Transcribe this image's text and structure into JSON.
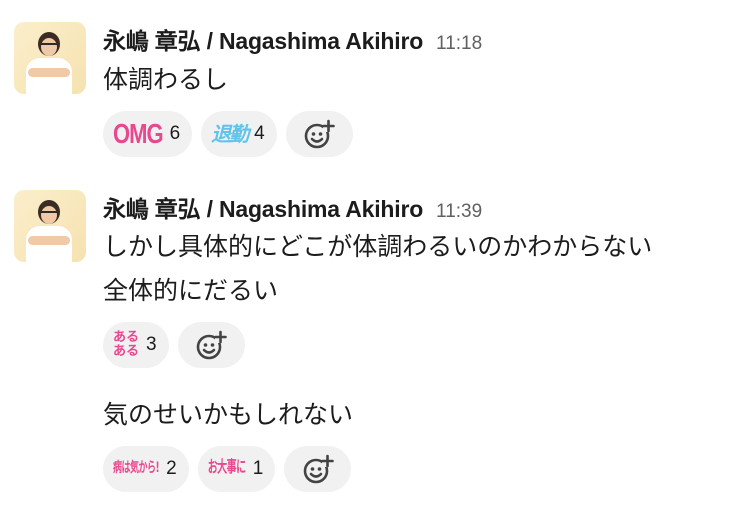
{
  "messages": [
    {
      "author": "永嶋 章弘 / Nagashima Akihiro",
      "time": "11:18",
      "lines": [
        "体調わるし"
      ],
      "reactions": [
        {
          "emoji": "OMG",
          "icon": "omg-emoji-icon",
          "count": "6",
          "color": "#e8488f"
        },
        {
          "emoji": "退勤",
          "icon": "taikin-emoji-icon",
          "count": "4",
          "color": "#5fc3ea"
        }
      ]
    },
    {
      "author": "永嶋 章弘 / Nagashima Akihiro",
      "time": "11:39",
      "lines": [
        "しかし具体的にどこが体調わるいのかわからない",
        "全体的にだるい"
      ],
      "reactions": [
        {
          "emoji": "ある\nある",
          "icon": "aruaru-emoji-icon",
          "count": "3",
          "color": "#e8488f"
        }
      ]
    },
    {
      "lines": [
        "気のせいかもしれない"
      ],
      "reactions": [
        {
          "emoji": "病は気から!",
          "icon": "yamai-wa-ki-kara-emoji-icon",
          "count": "2",
          "color": "#e8488f"
        },
        {
          "emoji": "お大事に",
          "icon": "odaijini-emoji-icon",
          "count": "1",
          "color": "#e8488f"
        }
      ]
    }
  ]
}
